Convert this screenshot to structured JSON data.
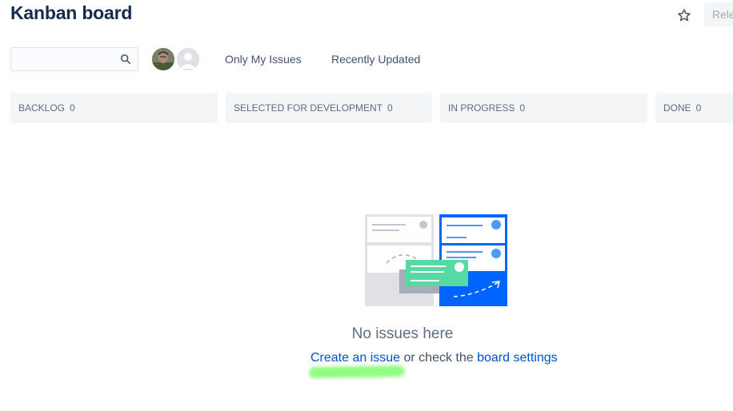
{
  "page": {
    "title": "Kanban board"
  },
  "header": {
    "release_label": "Rele"
  },
  "search": {
    "value": "",
    "placeholder": ""
  },
  "filters": {
    "only_my_issues": "Only My Issues",
    "recently_updated": "Recently Updated"
  },
  "columns": [
    {
      "name": "BACKLOG",
      "count": "0"
    },
    {
      "name": "SELECTED FOR DEVELOPMENT",
      "count": "0"
    },
    {
      "name": "IN PROGRESS",
      "count": "0"
    },
    {
      "name": "DONE",
      "count": "0"
    }
  ],
  "empty_state": {
    "title": "No issues here",
    "create_link": "Create an issue",
    "middle_text": " or check the ",
    "settings_link": "board settings"
  },
  "icons": {
    "star": "star-icon",
    "search": "search-icon",
    "avatar_default": "user-placeholder-icon"
  },
  "colors": {
    "title": "#172b4d",
    "link": "#0052cc",
    "column_bg": "#f4f5f7",
    "muted_text": "#5e6c84",
    "illustration_blue": "#0065ff",
    "illustration_green": "#57d9a3",
    "highlight_green": "#7cfc6a"
  }
}
